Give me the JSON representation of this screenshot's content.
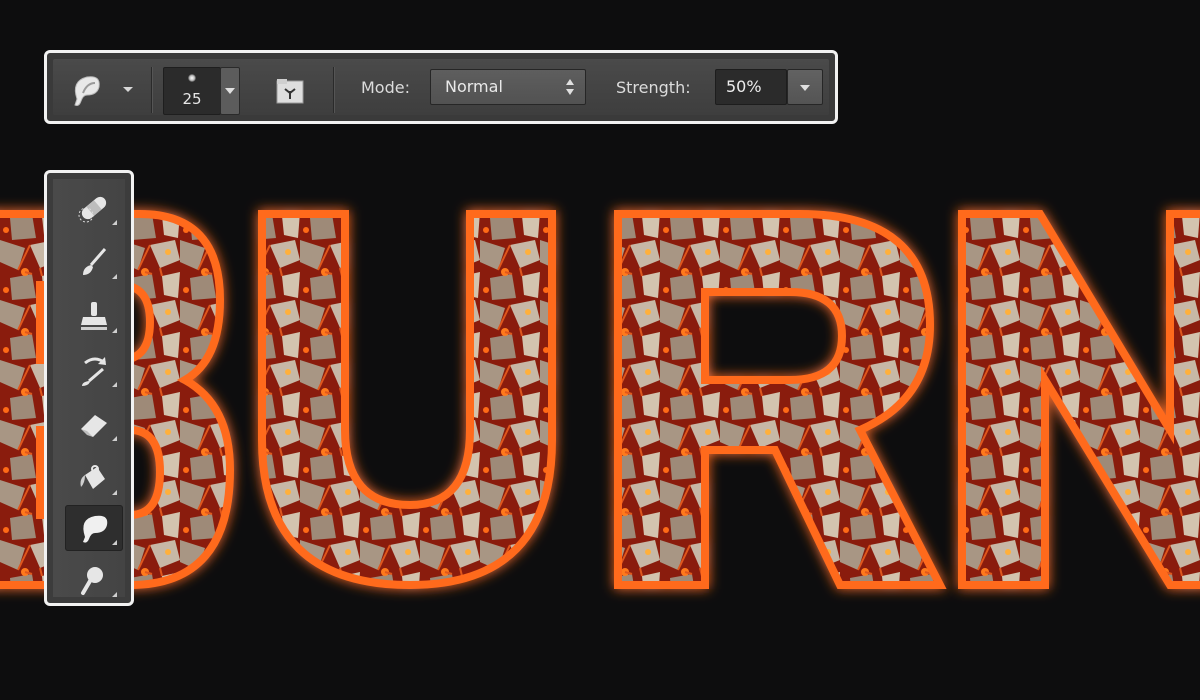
{
  "options_bar": {
    "tool_icon": "smudge-icon",
    "brush_size": "25",
    "panel_toggle_icon": "brush-panel-icon",
    "mode_label": "Mode:",
    "mode_value": "Normal",
    "strength_label": "Strength:",
    "strength_value": "50%"
  },
  "tools": [
    {
      "name": "spot-healing-brush",
      "icon": "bandage-icon",
      "active": false
    },
    {
      "name": "brush",
      "icon": "brush-icon",
      "active": false
    },
    {
      "name": "clone-stamp",
      "icon": "stamp-icon",
      "active": false
    },
    {
      "name": "history-brush",
      "icon": "history-brush-icon",
      "active": false
    },
    {
      "name": "eraser",
      "icon": "eraser-icon",
      "active": false
    },
    {
      "name": "paint-bucket",
      "icon": "bucket-icon",
      "active": false
    },
    {
      "name": "smudge",
      "icon": "smudge-icon",
      "active": true
    },
    {
      "name": "dodge",
      "icon": "dodge-icon",
      "active": false
    }
  ],
  "canvas": {
    "artwork_text": "BURN",
    "colors": {
      "background": "#0d0d0e",
      "fire": "#e0561a",
      "ember": "#8a1e0c",
      "glow": "#ff9a3a",
      "rock": "#b8a896"
    }
  }
}
